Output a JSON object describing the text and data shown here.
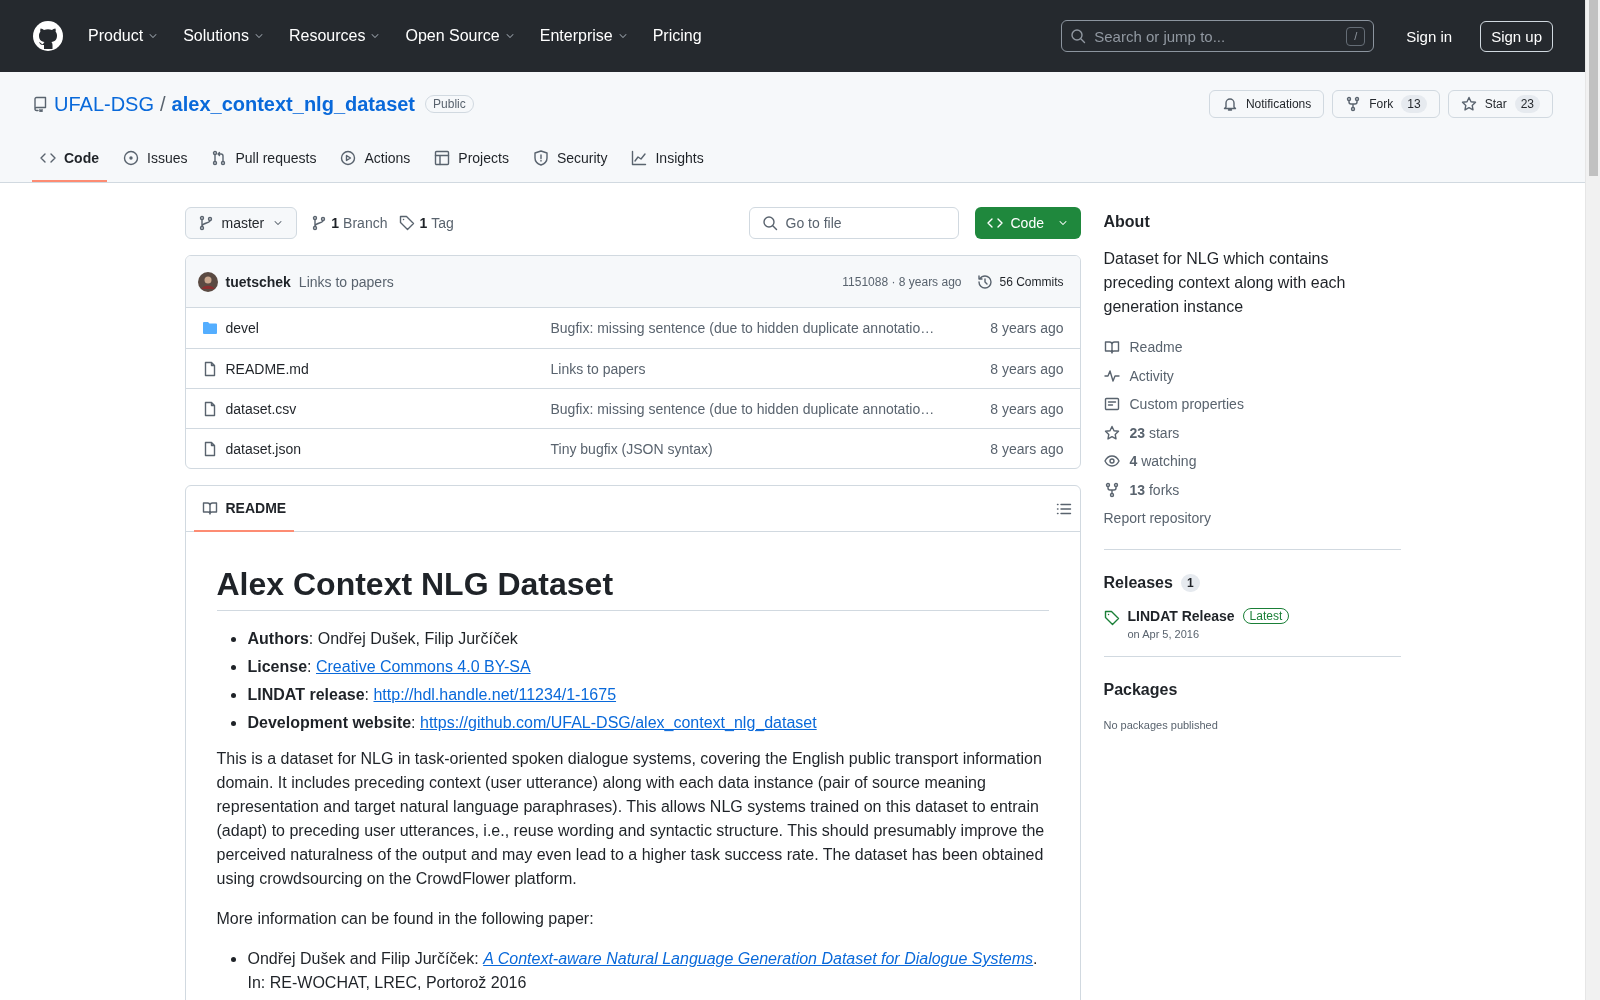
{
  "header": {
    "nav": [
      {
        "label": "Product",
        "caret": true
      },
      {
        "label": "Solutions",
        "caret": true
      },
      {
        "label": "Resources",
        "caret": true
      },
      {
        "label": "Open Source",
        "caret": true
      },
      {
        "label": "Enterprise",
        "caret": true
      },
      {
        "label": "Pricing",
        "caret": false
      }
    ],
    "search": {
      "placeholder": "Search or jump to...",
      "key": "/"
    },
    "sign_in": "Sign in",
    "sign_up": "Sign up"
  },
  "repo": {
    "owner": "UFAL-DSG",
    "separator": "/",
    "name": "alex_context_nlg_dataset",
    "visibility": "Public",
    "actions": [
      {
        "kind": "notifications",
        "label": "Notifications"
      },
      {
        "kind": "fork",
        "label": "Fork",
        "count": "13"
      },
      {
        "kind": "star",
        "label": "Star",
        "count": "23"
      }
    ]
  },
  "tabs": [
    {
      "label": "Code",
      "selected": true
    },
    {
      "label": "Issues",
      "selected": false
    },
    {
      "label": "Pull requests",
      "selected": false
    },
    {
      "label": "Actions",
      "selected": false
    },
    {
      "label": "Projects",
      "selected": false
    },
    {
      "label": "Security",
      "selected": false
    },
    {
      "label": "Insights",
      "selected": false
    }
  ],
  "toolbar": {
    "branch": "master",
    "branches_count": "1",
    "branches_label": "Branch",
    "tags_count": "1",
    "tags_label": "Tag",
    "go_to_file": "Go to file",
    "code_button": "Code"
  },
  "latest_commit": {
    "author": "tuetschek",
    "message": "Links to papers",
    "hash_age": "1151088 · 8 years ago",
    "commits": "56 Commits"
  },
  "files": [
    {
      "kind": "folder",
      "name": "devel",
      "message": "Bugfix: missing sentence (due to hidden duplicate annotatio…",
      "age": "8 years ago"
    },
    {
      "kind": "file",
      "name": "README.md",
      "message": "Links to papers",
      "age": "8 years ago"
    },
    {
      "kind": "file",
      "name": "dataset.csv",
      "message": "Bugfix: missing sentence (due to hidden duplicate annotatio…",
      "age": "8 years ago"
    },
    {
      "kind": "file",
      "name": "dataset.json",
      "message": "Tiny bugfix (JSON syntax)",
      "age": "8 years ago"
    }
  ],
  "readme": {
    "tab": "README",
    "title": "Alex Context NLG Dataset",
    "facts": [
      {
        "lead": "**Authors**: Ondřej Dušek, Filip Jurčíček"
      },
      {
        "lead": "**License**: ",
        "link": "Creative Commons 4.0 BY-SA"
      },
      {
        "lead": "**LINDAT release**: ",
        "link": "http://hdl.handle.net/11234/1-1675"
      },
      {
        "lead": "**Development website**: ",
        "link": "https://github.com/UFAL-DSG/alex_context_nlg_dataset"
      }
    ],
    "paragraphs": [
      "This is a dataset for NLG in task-oriented spoken dialogue systems, covering the English public transport information domain. It includes preceding context (user utterance) along with each data instance (pair of source meaning representation and target natural language paraphrases). This allows NLG systems trained on this dataset to entrain (adapt) to preceding user utterances, i.e., reuse wording and syntactic structure. This should presumably improve the perceived naturalness of the output and may even lead to a higher task success rate. The dataset has been obtained using crowdsourcing on the CrowdFlower platform.",
      "More information can be found in the following paper:"
    ],
    "papers": [
      {
        "lead": "Ondřej Dušek and Filip Jurčíček: ",
        "link": "A Context-aware Natural Language Generation Dataset for Dialogue Systems",
        "tail": ".",
        "note": "In: RE-WOCHAT, LREC, Portorož 2016"
      }
    ]
  },
  "sidebar": {
    "about": "About",
    "description": "Dataset for NLG which contains preceding context along with each generation instance",
    "links": [
      {
        "text": "Readme"
      },
      {
        "text": "Activity"
      },
      {
        "text": "Custom properties"
      },
      {
        "text": "**23** stars"
      },
      {
        "text": "**4** watching"
      },
      {
        "text": "**13** forks"
      }
    ],
    "report": "Report repository",
    "releases": {
      "title": "Releases",
      "count": "1",
      "items": [
        {
          "name": "LINDAT Release",
          "badge": "Latest",
          "date": "on Apr 5, 2016"
        }
      ]
    },
    "packages": {
      "title": "Packages",
      "empty": "No packages published"
    }
  }
}
